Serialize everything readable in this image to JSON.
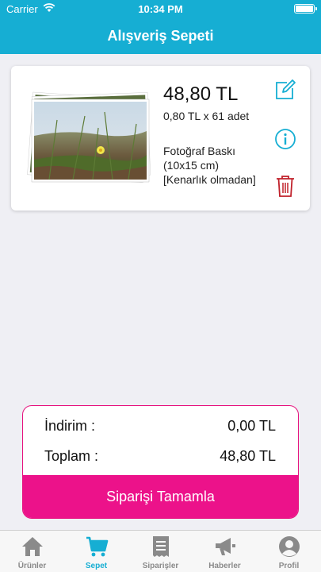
{
  "status_bar": {
    "carrier": "Carrier",
    "time": "10:34 PM"
  },
  "header": {
    "title": "Alışveriş Sepeti"
  },
  "cart_item": {
    "price": "48,80 TL",
    "unit_price": "0,80 TL x 61 adet",
    "product_lines": [
      "Fotoğraf Baskı",
      "(10x15 cm)",
      "[Kenarlık olmadan]"
    ]
  },
  "summary": {
    "discount_label": "İndirim :",
    "discount_value": "0,00 TL",
    "total_label": "Toplam :",
    "total_value": "48,80 TL",
    "checkout_label": "Siparişi Tamamla"
  },
  "tabs": [
    {
      "label": "Ürünler",
      "icon": "home-icon"
    },
    {
      "label": "Sepet",
      "icon": "cart-icon",
      "active": true
    },
    {
      "label": "Siparişler",
      "icon": "receipt-icon"
    },
    {
      "label": "Haberler",
      "icon": "megaphone-icon"
    },
    {
      "label": "Profil",
      "icon": "user-icon"
    }
  ],
  "colors": {
    "header": "#16aed3",
    "accent": "#ec128a",
    "delete": "#c0202a",
    "tab_inactive": "#8a8a8a"
  }
}
